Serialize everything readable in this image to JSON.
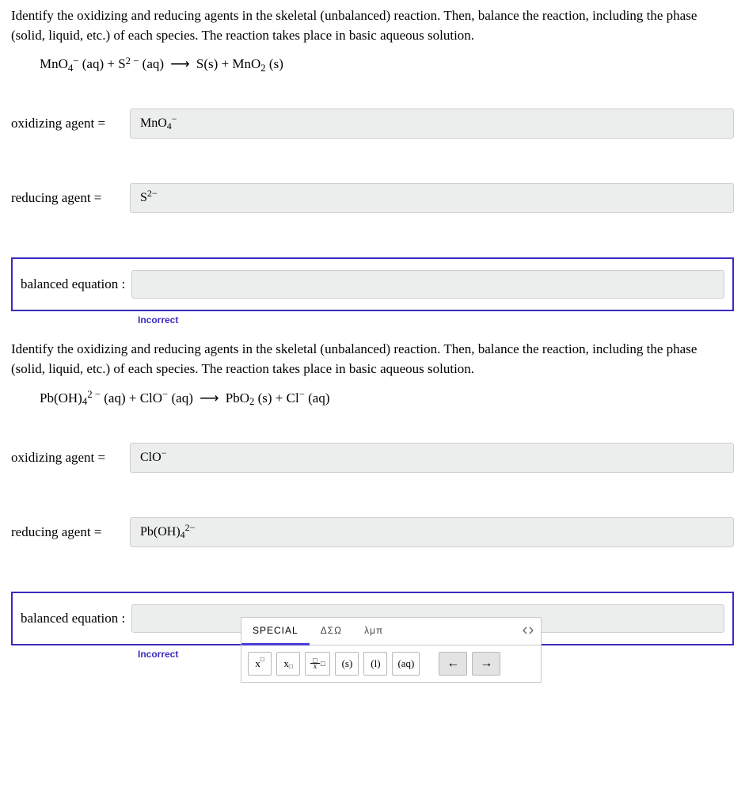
{
  "q1": {
    "prompt": "Identify the oxidizing and reducing agents in the skeletal (unbalanced) reaction. Then, balance the reaction, including the phase (solid, liquid, etc.) of each species. The reaction takes place in basic aqueous solution.",
    "oxidizing_label": "oxidizing agent =",
    "reducing_label": "reducing agent =",
    "balanced_label": "balanced equation :",
    "oxidizing_value_html": "MnO<span class='sub'>4</span><span class='sup'>−</span>",
    "reducing_value_html": "S<span class='sup'>2−</span>",
    "incorrect": "Incorrect",
    "equation_html": "MnO<span class='sub'>4</span><span class='sup'>−</span> (aq) + S<span class='sup'>2 −</span> (aq) <span class='arrow'>⟶</span> S(s) + MnO<span class='sub'>2</span> (s)"
  },
  "q2": {
    "prompt": "Identify the oxidizing and reducing agents in the skeletal (unbalanced) reaction. Then, balance the reaction, including the phase (solid, liquid, etc.) of each species. The reaction takes place in basic aqueous solution.",
    "oxidizing_label": "oxidizing agent =",
    "reducing_label": "reducing agent =",
    "balanced_label": "balanced equation :",
    "oxidizing_value_html": "ClO<span class='sup'>−</span>",
    "reducing_value_html": "Pb(OH)<span class='sub'>4</span><span class='sup'>2−</span>",
    "incorrect": "Incorrect",
    "equation_html": "Pb(OH)<span class='sub'>4</span><span class='sup'>2 −</span> (aq) + ClO<span class='sup'>−</span> (aq) <span class='arrow'>⟶</span> PbO<span class='sub'>2</span> (s) + Cl<span class='sup'>−</span> (aq)"
  },
  "palette": {
    "tabs": [
      "SPECIAL",
      "ΔΣΩ",
      "λμπ"
    ],
    "buttons": {
      "sup": "x<span class='bx' style='position:relative;top:-5px;'>□</span>",
      "sub": "x<span class='bx' style='position:relative;top:4px;'>□</span>",
      "frac": "<span style='display:flex;flex-direction:column;align-items:center;line-height:0.7;font-size:9px;'><span>□</span><span style='border-top:1px solid #000;width:12px;'></span><span>x</span></span><span style='margin-left:1px;font-size:9px;'>□</span>",
      "s": "(s)",
      "l": "(l)",
      "aq": "(aq)",
      "left": "←",
      "right": "→"
    }
  }
}
